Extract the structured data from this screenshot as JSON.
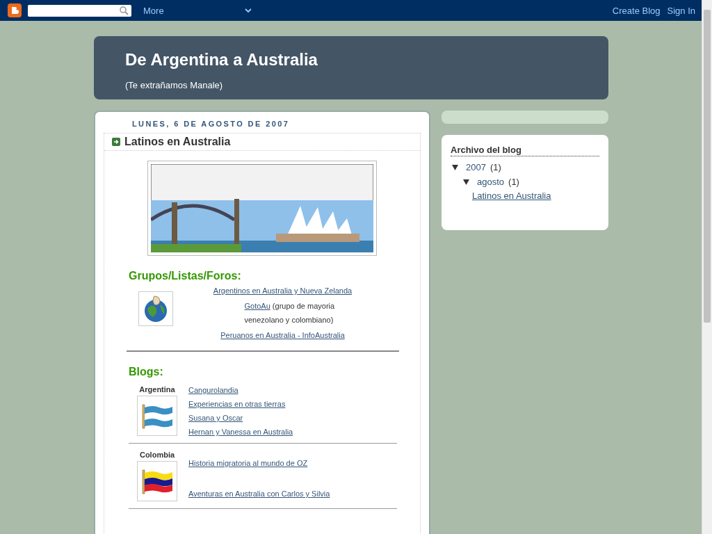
{
  "navbar": {
    "more": "More",
    "links": [
      "Create Blog",
      "Sign In"
    ]
  },
  "header": {
    "title": "De Argentina a Australia",
    "description": "(Te extrañamos Manale)"
  },
  "post": {
    "date": "LUNES, 6 DE AGOSTO DE 2007",
    "title": "Latinos en Australia",
    "groups": {
      "heading": "Grupos/Listas/Foros:",
      "items": [
        {
          "link": "Argentinos en Australia y Nueva Zelanda"
        },
        {
          "link": "GotoAu",
          "text": "(grupo de mayoria venezolano y colombiano)"
        },
        {
          "link": "Peruanos en Australia - InfoAustralia"
        }
      ]
    },
    "blogs": {
      "heading": "Blogs:",
      "countries": [
        {
          "name": "Argentina",
          "kind": "argentina",
          "links": [
            "Cangurolandia",
            "Experiencias en otras tierras",
            "Susana y Oscar",
            "Hernan y Vanessa en Australia"
          ]
        },
        {
          "name": "Colombia",
          "kind": "colombia",
          "links": [
            "Historia migratoria al mundo de OZ",
            "Aventuras en Australia con Carlos y Silvia"
          ]
        }
      ]
    }
  },
  "sidebar": {
    "archive": {
      "title": "Archivo del blog",
      "tree": [
        {
          "label": "2007",
          "count": "(1)",
          "expanded": true,
          "children": [
            {
              "label": "agosto",
              "count": "(1)",
              "expanded": true,
              "children": [
                {
                  "label": "Latinos en Australia"
                }
              ]
            }
          ]
        }
      ]
    }
  }
}
